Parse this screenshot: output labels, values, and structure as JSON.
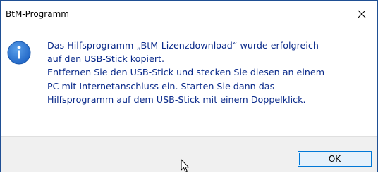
{
  "window": {
    "title": "BtM-Programm",
    "close_glyph": "✕"
  },
  "dialog": {
    "icon": "information-icon",
    "message_lines": [
      "Das Hilfsprogramm „BtM-Lizenzdownload“ wurde erfolgreich",
      "auf den USB-Stick kopiert.",
      "Entfernen Sie den USB-Stick und stecken Sie diesen an einem",
      "PC mit Internetanschluss ein. Starten Sie dann das",
      "Hilfsprogramm auf dem USB-Stick mit einem Doppelklick."
    ],
    "message_color": "#0a2a8a"
  },
  "buttons": {
    "ok_label": "OK"
  },
  "colors": {
    "accent": "#0078d7",
    "border": "#1f4f94",
    "footer_bg": "#f0f0f0",
    "icon_blue": "#1e73d2"
  }
}
